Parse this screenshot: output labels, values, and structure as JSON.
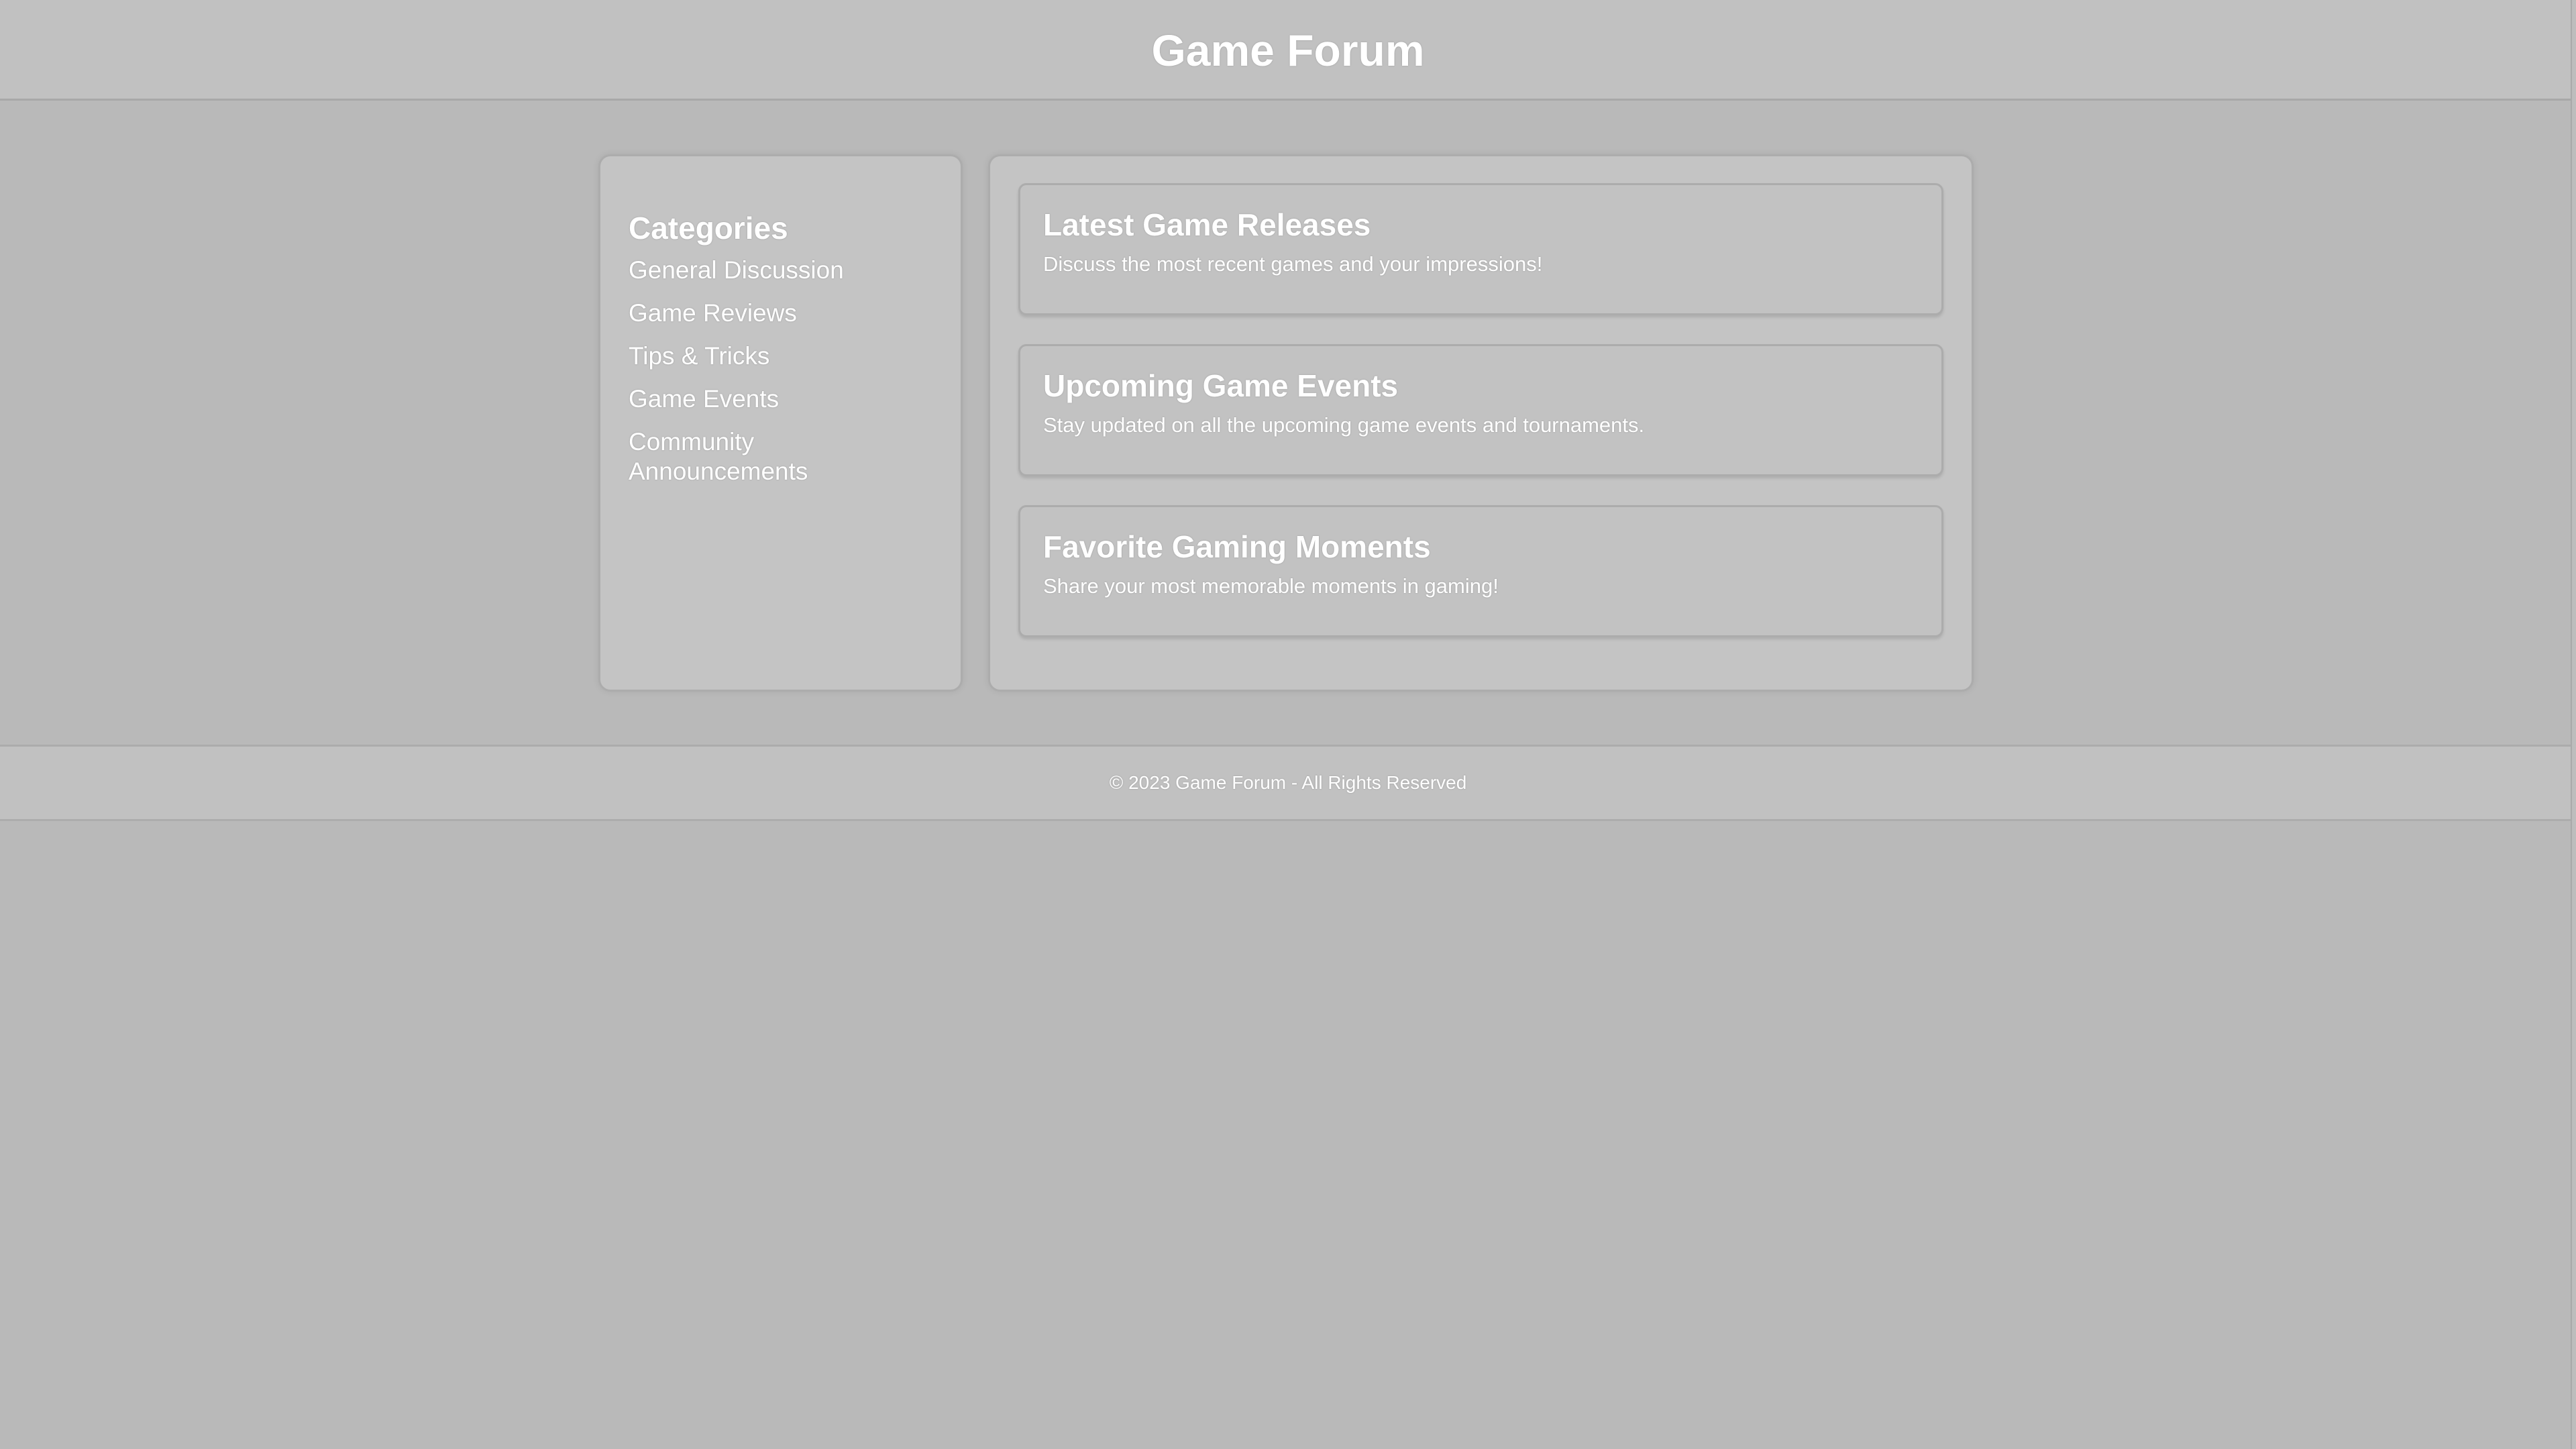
{
  "header": {
    "title": "Game Forum"
  },
  "sidebar": {
    "heading": "Categories",
    "items": [
      {
        "label": "General Discussion"
      },
      {
        "label": "Game Reviews"
      },
      {
        "label": "Tips & Tricks"
      },
      {
        "label": "Game Events"
      },
      {
        "label": "Community Announcements"
      }
    ]
  },
  "topics": [
    {
      "title": "Latest Game Releases",
      "description": "Discuss the most recent games and your impressions!"
    },
    {
      "title": "Upcoming Game Events",
      "description": "Stay updated on all the upcoming game events and tournaments."
    },
    {
      "title": "Favorite Gaming Moments",
      "description": "Share your most memorable moments in gaming!"
    }
  ],
  "footer": {
    "text": "© 2023 Game Forum - All Rights Reserved"
  }
}
